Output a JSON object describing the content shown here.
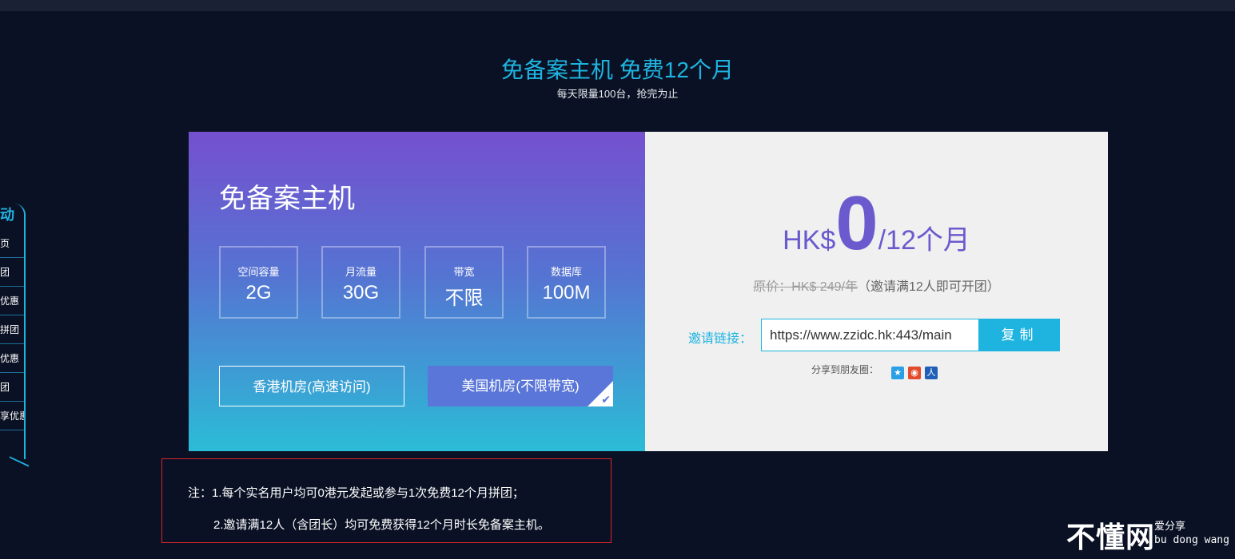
{
  "hero": {
    "title": "免备案主机 免费12个月",
    "subtitle": "每天限量100台，抢完为止"
  },
  "side_menu": {
    "title": "动",
    "items": [
      "页",
      "团",
      "优惠",
      "拼团",
      "优惠",
      "团",
      "享优惠"
    ]
  },
  "product": {
    "name": "免备案主机",
    "specs": [
      {
        "label": "空间容量",
        "value": "2G"
      },
      {
        "label": "月流量",
        "value": "30G"
      },
      {
        "label": "带宽",
        "value": "不限"
      },
      {
        "label": "数据库",
        "value": "100M"
      }
    ],
    "datacenters": [
      {
        "label": "香港机房(高速访问)",
        "selected": false
      },
      {
        "label": "美国机房(不限带宽)",
        "selected": true
      }
    ]
  },
  "pricing": {
    "currency": "HK$",
    "price": "0",
    "period": "/12个月",
    "original": "原价：HK$ 249/年",
    "original_note": "（邀请满12人即可开团）"
  },
  "invite": {
    "label": "邀请链接：",
    "url": "https://www.zzidc.hk:443/main",
    "copy_label": "复制",
    "share_label": "分享到朋友圈：",
    "share_icons": [
      "qzone-icon",
      "weibo-icon",
      "renren-icon"
    ]
  },
  "notes": {
    "line1": "注：1.每个实名用户均可0港元发起或参与1次免费12个月拼团；",
    "line2": "2.邀请满12人（含团长）均可免费获得12个月时长免备案主机。"
  },
  "watermark": {
    "main": "不懂网",
    "tagline": "爱分享",
    "pinyin": "bu dong wang"
  },
  "colors": {
    "background": "#0a1124",
    "accent": "#1fb4e0",
    "price": "#6a5acd",
    "note_border": "#d8262a"
  }
}
